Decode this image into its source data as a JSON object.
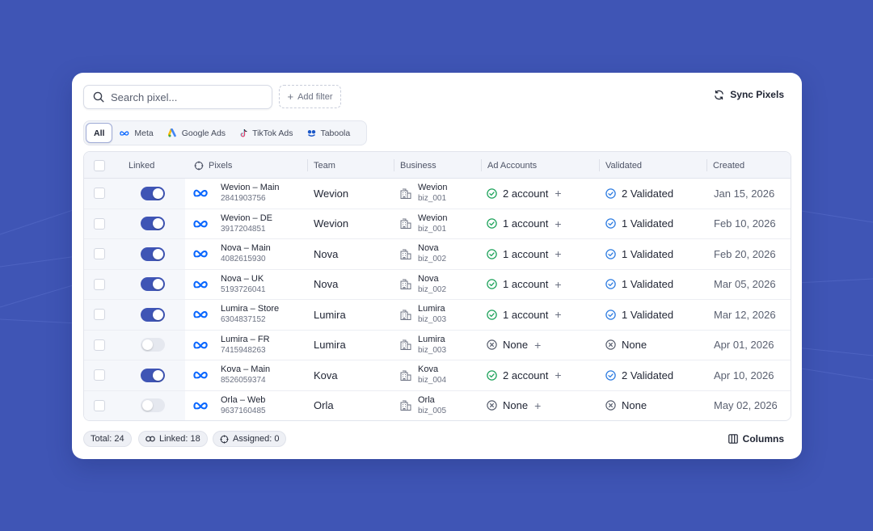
{
  "search": {
    "placeholder": "Search pixel..."
  },
  "add_filter_label": "Add filter",
  "sync_label": "Sync Pixels",
  "tabs": [
    {
      "label": "All",
      "icon": "none",
      "active": true
    },
    {
      "label": "Meta",
      "icon": "meta-icon",
      "active": false
    },
    {
      "label": "Google Ads",
      "icon": "google-ads-icon",
      "active": false
    },
    {
      "label": "TikTok Ads",
      "icon": "tiktok-icon",
      "active": false
    },
    {
      "label": "Taboola",
      "icon": "taboola-icon",
      "active": false
    }
  ],
  "columns": {
    "linked": "Linked",
    "pixels": "Pixels",
    "team": "Team",
    "business": "Business",
    "ad_accounts": "Ad Accounts",
    "validated": "Validated",
    "created": "Created"
  },
  "rows": [
    {
      "linked": true,
      "pixel_name": "Wevion – Main",
      "pixel_id": "2841903756",
      "team": "Wevion",
      "business_name": "Wevion",
      "business_id": "biz_001",
      "ad_accounts": "2 account",
      "ad_ok": true,
      "validated": "2 Validated",
      "val_ok": true,
      "created": "Jan 15, 2026"
    },
    {
      "linked": true,
      "pixel_name": "Wevion – DE",
      "pixel_id": "3917204851",
      "team": "Wevion",
      "business_name": "Wevion",
      "business_id": "biz_001",
      "ad_accounts": "1 account",
      "ad_ok": true,
      "validated": "1 Validated",
      "val_ok": true,
      "created": "Feb 10, 2026"
    },
    {
      "linked": true,
      "pixel_name": "Nova – Main",
      "pixel_id": "4082615930",
      "team": "Nova",
      "business_name": "Nova",
      "business_id": "biz_002",
      "ad_accounts": "1 account",
      "ad_ok": true,
      "validated": "1 Validated",
      "val_ok": true,
      "created": "Feb 20, 2026"
    },
    {
      "linked": true,
      "pixel_name": "Nova – UK",
      "pixel_id": "5193726041",
      "team": "Nova",
      "business_name": "Nova",
      "business_id": "biz_002",
      "ad_accounts": "1 account",
      "ad_ok": true,
      "validated": "1 Validated",
      "val_ok": true,
      "created": "Mar 05, 2026"
    },
    {
      "linked": true,
      "pixel_name": "Lumira – Store",
      "pixel_id": "6304837152",
      "team": "Lumira",
      "business_name": "Lumira",
      "business_id": "biz_003",
      "ad_accounts": "1 account",
      "ad_ok": true,
      "validated": "1 Validated",
      "val_ok": true,
      "created": "Mar 12, 2026"
    },
    {
      "linked": false,
      "pixel_name": "Lumira – FR",
      "pixel_id": "7415948263",
      "team": "Lumira",
      "business_name": "Lumira",
      "business_id": "biz_003",
      "ad_accounts": "None",
      "ad_ok": false,
      "validated": "None",
      "val_ok": false,
      "created": "Apr 01, 2026"
    },
    {
      "linked": true,
      "pixel_name": "Kova – Main",
      "pixel_id": "8526059374",
      "team": "Kova",
      "business_name": "Kova",
      "business_id": "biz_004",
      "ad_accounts": "2 account",
      "ad_ok": true,
      "validated": "2 Validated",
      "val_ok": true,
      "created": "Apr 10, 2026"
    },
    {
      "linked": false,
      "pixel_name": "Orla – Web",
      "pixel_id": "9637160485",
      "team": "Orla",
      "business_name": "Orla",
      "business_id": "biz_005",
      "ad_accounts": "None",
      "ad_ok": false,
      "validated": "None",
      "val_ok": false,
      "created": "May 02, 2026"
    }
  ],
  "footer": {
    "total": "Total: 24",
    "linked": "Linked: 18",
    "assigned": "Assigned: 0",
    "columns_label": "Columns"
  },
  "colors": {
    "background": "#3f55b5",
    "accent": "#3f55b5",
    "meta_blue": "#0866ff",
    "ok_green": "#1fa35c",
    "validated_blue": "#2f7de1",
    "muted": "#6b7182"
  }
}
